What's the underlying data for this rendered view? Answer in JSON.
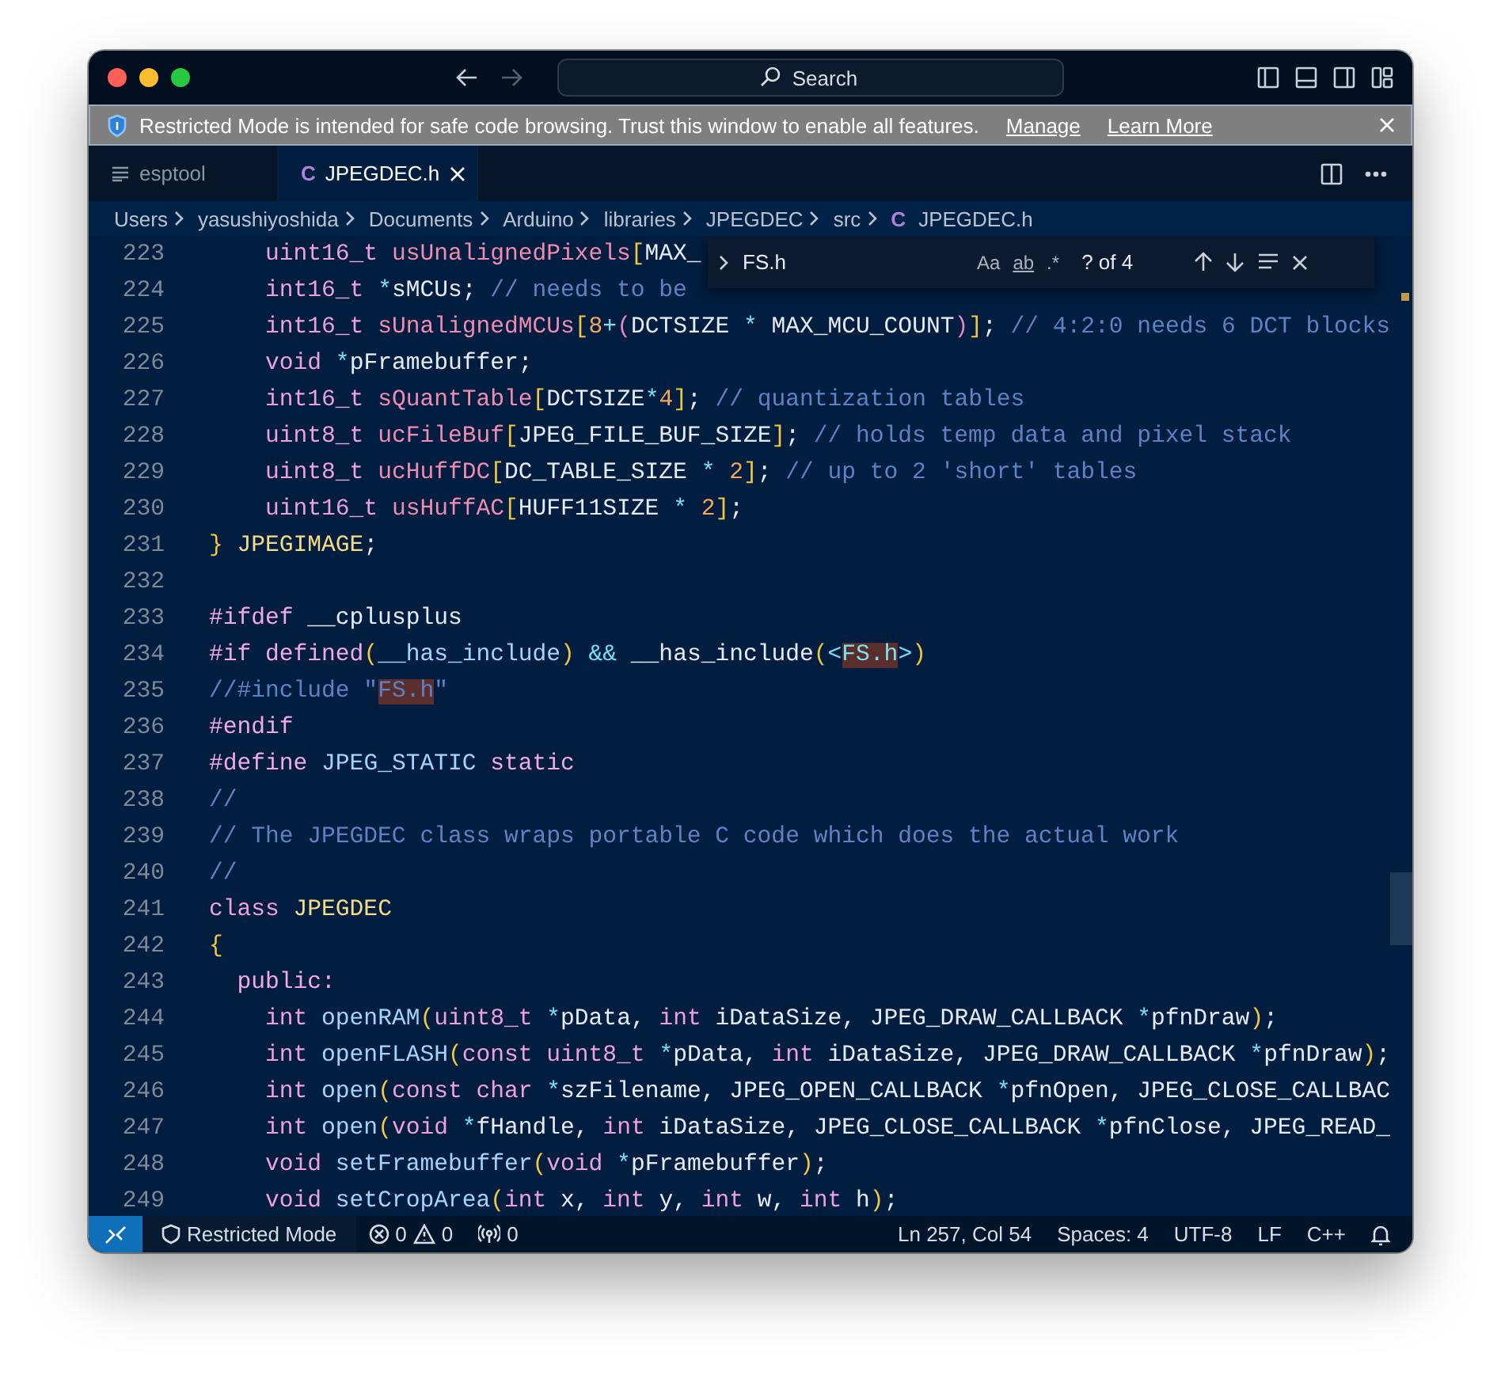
{
  "title_bar": {
    "search": {
      "placeholder": "Search"
    }
  },
  "banner": {
    "message": "Restricted Mode is intended for safe code browsing. Trust this window to enable all features.",
    "links": [
      "Manage",
      "Learn More"
    ]
  },
  "tabs": [
    {
      "label": "esptool",
      "kind": "text",
      "selected": false
    },
    {
      "label": "JPEGDEC.h",
      "kind": "c",
      "icon_text": "C",
      "selected": true
    }
  ],
  "breadcrumb": [
    {
      "label": "Users"
    },
    {
      "label": "yasushiyoshida"
    },
    {
      "label": "Documents"
    },
    {
      "label": "Arduino"
    },
    {
      "label": "libraries"
    },
    {
      "label": "JPEGDEC"
    },
    {
      "label": "src"
    },
    {
      "label": "JPEGDEC.h",
      "icon_text": "C"
    }
  ],
  "find_widget": {
    "value": "FS.h",
    "options": [
      "Aa",
      "ab",
      ".*"
    ],
    "result": "? of 4"
  },
  "editor": {
    "lines": [
      {
        "number": "223",
        "tokens": [
          {
            "text": "    uint16_t ",
            "kind": "type"
          },
          {
            "text": "usUnalignedPixels",
            "kind": "member"
          },
          {
            "text": "[",
            "kind": "bracket"
          },
          {
            "text": "MAX_",
            "kind": "plain"
          }
        ]
      },
      {
        "number": "224",
        "tokens": [
          {
            "text": "    int16_t ",
            "kind": "type"
          },
          {
            "text": "*",
            "kind": "op"
          },
          {
            "text": "sMCUs;",
            "kind": "plain"
          },
          {
            "text": " // needs to be",
            "kind": "comment"
          }
        ]
      },
      {
        "number": "225",
        "tokens": [
          {
            "text": "    int16_t ",
            "kind": "type"
          },
          {
            "text": "sUnalignedMCUs",
            "kind": "member"
          },
          {
            "text": "[",
            "kind": "bracket"
          },
          {
            "text": "8",
            "kind": "num"
          },
          {
            "text": "+",
            "kind": "op"
          },
          {
            "text": "(",
            "kind": "bracket2"
          },
          {
            "text": "DCTSIZE ",
            "kind": "plain"
          },
          {
            "text": "*",
            "kind": "op"
          },
          {
            "text": " MAX_MCU_COUNT",
            "kind": "plain"
          },
          {
            "text": ")",
            "kind": "bracket2"
          },
          {
            "text": "]",
            "kind": "bracket"
          },
          {
            "text": ";",
            "kind": "plain"
          },
          {
            "text": " // 4:2:0 needs 6 DCT blocks",
            "kind": "comment"
          }
        ]
      },
      {
        "number": "226",
        "tokens": [
          {
            "text": "    void ",
            "kind": "type"
          },
          {
            "text": "*",
            "kind": "op"
          },
          {
            "text": "pFramebuffer;",
            "kind": "plain"
          }
        ]
      },
      {
        "number": "227",
        "tokens": [
          {
            "text": "    int16_t ",
            "kind": "type"
          },
          {
            "text": "sQuantTable",
            "kind": "member"
          },
          {
            "text": "[",
            "kind": "bracket"
          },
          {
            "text": "DCTSIZE",
            "kind": "plain"
          },
          {
            "text": "*",
            "kind": "op"
          },
          {
            "text": "4",
            "kind": "num"
          },
          {
            "text": "]",
            "kind": "bracket"
          },
          {
            "text": ";",
            "kind": "plain"
          },
          {
            "text": " // quantization tables",
            "kind": "comment"
          }
        ]
      },
      {
        "number": "228",
        "tokens": [
          {
            "text": "    uint8_t ",
            "kind": "type"
          },
          {
            "text": "ucFileBuf",
            "kind": "member"
          },
          {
            "text": "[",
            "kind": "bracket"
          },
          {
            "text": "JPEG_FILE_BUF_SIZE",
            "kind": "plain"
          },
          {
            "text": "]",
            "kind": "bracket"
          },
          {
            "text": ";",
            "kind": "plain"
          },
          {
            "text": " // holds temp data and pixel stack",
            "kind": "comment"
          }
        ]
      },
      {
        "number": "229",
        "tokens": [
          {
            "text": "    uint8_t ",
            "kind": "type"
          },
          {
            "text": "ucHuffDC",
            "kind": "member"
          },
          {
            "text": "[",
            "kind": "bracket"
          },
          {
            "text": "DC_TABLE_SIZE ",
            "kind": "plain"
          },
          {
            "text": "* ",
            "kind": "op"
          },
          {
            "text": "2",
            "kind": "num"
          },
          {
            "text": "]",
            "kind": "bracket"
          },
          {
            "text": ";",
            "kind": "plain"
          },
          {
            "text": " // up to 2 'short' tables",
            "kind": "comment"
          }
        ]
      },
      {
        "number": "230",
        "tokens": [
          {
            "text": "    uint16_t ",
            "kind": "type"
          },
          {
            "text": "usHuffAC",
            "kind": "member"
          },
          {
            "text": "[",
            "kind": "bracket"
          },
          {
            "text": "HUFF11SIZE ",
            "kind": "plain"
          },
          {
            "text": "* ",
            "kind": "op"
          },
          {
            "text": "2",
            "kind": "num"
          },
          {
            "text": "]",
            "kind": "bracket"
          },
          {
            "text": ";",
            "kind": "plain"
          }
        ]
      },
      {
        "number": "231",
        "tokens": [
          {
            "text": "}",
            "kind": "bracket"
          },
          {
            "text": " JPEGIMAGE",
            "kind": "name"
          },
          {
            "text": ";",
            "kind": "plain"
          }
        ]
      },
      {
        "number": "232"
      },
      {
        "number": "233",
        "tokens": [
          {
            "text": "#ifdef",
            "kind": "directive"
          },
          {
            "text": " __cplusplus",
            "kind": "plain"
          }
        ]
      },
      {
        "number": "234",
        "tokens": [
          {
            "text": "#if defined",
            "kind": "directive"
          },
          {
            "text": "(",
            "kind": "bracket"
          },
          {
            "text": "__has_include",
            "kind": "func"
          },
          {
            "text": ")",
            "kind": "bracket"
          },
          {
            "text": " &&",
            "kind": "op"
          },
          {
            "text": " __has_include",
            "kind": "plain"
          },
          {
            "text": "(",
            "kind": "bracket"
          },
          {
            "text": "<",
            "kind": "op"
          },
          {
            "text": "FS.h",
            "kind": "match"
          },
          {
            "text": ">",
            "kind": "op"
          },
          {
            "text": ")",
            "kind": "bracket"
          }
        ]
      },
      {
        "number": "235",
        "tokens": [
          {
            "text": "//#include \"",
            "kind": "comment"
          },
          {
            "text": "FS.h",
            "kind": "comment-match"
          },
          {
            "text": "\"",
            "kind": "comment"
          }
        ]
      },
      {
        "number": "236",
        "tokens": [
          {
            "text": "#endif",
            "kind": "directive"
          }
        ]
      },
      {
        "number": "237",
        "tokens": [
          {
            "text": "#define",
            "kind": "directive"
          },
          {
            "text": " JPEG_STATIC ",
            "kind": "func"
          },
          {
            "text": "static",
            "kind": "directive"
          }
        ]
      },
      {
        "number": "238",
        "tokens": [
          {
            "text": "//",
            "kind": "comment"
          }
        ]
      },
      {
        "number": "239",
        "tokens": [
          {
            "text": "// The JPEGDEC class wraps portable C code which does the actual work",
            "kind": "comment"
          }
        ]
      },
      {
        "number": "240",
        "tokens": [
          {
            "text": "//",
            "kind": "comment"
          }
        ]
      },
      {
        "number": "241",
        "tokens": [
          {
            "text": "class",
            "kind": "type"
          },
          {
            "text": " JPEGDEC",
            "kind": "name"
          }
        ]
      },
      {
        "number": "242",
        "tokens": [
          {
            "text": "{",
            "kind": "bracket"
          }
        ]
      },
      {
        "number": "243",
        "tokens": [
          {
            "text": "  public:",
            "kind": "directive"
          }
        ]
      },
      {
        "number": "244",
        "tokens": [
          {
            "text": "    int ",
            "kind": "type"
          },
          {
            "text": "openRAM",
            "kind": "func"
          },
          {
            "text": "(",
            "kind": "bracket"
          },
          {
            "text": "uint8_t ",
            "kind": "type"
          },
          {
            "text": "*",
            "kind": "op"
          },
          {
            "text": "pData, ",
            "kind": "plain"
          },
          {
            "text": "int",
            "kind": "type"
          },
          {
            "text": " iDataSize, JPEG_DRAW_CALLBACK ",
            "kind": "plain"
          },
          {
            "text": "*",
            "kind": "op"
          },
          {
            "text": "pfnDraw",
            "kind": "plain"
          },
          {
            "text": ")",
            "kind": "bracket"
          },
          {
            "text": ";",
            "kind": "plain"
          }
        ]
      },
      {
        "number": "245",
        "tokens": [
          {
            "text": "    int ",
            "kind": "type"
          },
          {
            "text": "openFLASH",
            "kind": "func"
          },
          {
            "text": "(",
            "kind": "bracket"
          },
          {
            "text": "const uint8_t ",
            "kind": "type"
          },
          {
            "text": "*",
            "kind": "op"
          },
          {
            "text": "pData, ",
            "kind": "plain"
          },
          {
            "text": "int",
            "kind": "type"
          },
          {
            "text": " iDataSize, JPEG_DRAW_CALLBACK ",
            "kind": "plain"
          },
          {
            "text": "*",
            "kind": "op"
          },
          {
            "text": "pfnDraw",
            "kind": "plain"
          },
          {
            "text": ")",
            "kind": "bracket"
          },
          {
            "text": ";",
            "kind": "plain"
          }
        ]
      },
      {
        "number": "246",
        "tokens": [
          {
            "text": "    int ",
            "kind": "type"
          },
          {
            "text": "open",
            "kind": "func"
          },
          {
            "text": "(",
            "kind": "bracket"
          },
          {
            "text": "const char ",
            "kind": "type"
          },
          {
            "text": "*",
            "kind": "op"
          },
          {
            "text": "szFilename, JPEG_OPEN_CALLBACK ",
            "kind": "plain"
          },
          {
            "text": "*",
            "kind": "op"
          },
          {
            "text": "pfnOpen, JPEG_CLOSE_CALLBAC",
            "kind": "plain"
          }
        ]
      },
      {
        "number": "247",
        "tokens": [
          {
            "text": "    int ",
            "kind": "type"
          },
          {
            "text": "open",
            "kind": "func"
          },
          {
            "text": "(",
            "kind": "bracket"
          },
          {
            "text": "void ",
            "kind": "type"
          },
          {
            "text": "*",
            "kind": "op"
          },
          {
            "text": "fHandle, ",
            "kind": "plain"
          },
          {
            "text": "int",
            "kind": "type"
          },
          {
            "text": " iDataSize, JPEG_CLOSE_CALLBACK ",
            "kind": "plain"
          },
          {
            "text": "*",
            "kind": "op"
          },
          {
            "text": "pfnClose, JPEG_READ_",
            "kind": "plain"
          }
        ]
      },
      {
        "number": "248",
        "tokens": [
          {
            "text": "    void ",
            "kind": "type"
          },
          {
            "text": "setFramebuffer",
            "kind": "func"
          },
          {
            "text": "(",
            "kind": "bracket"
          },
          {
            "text": "void ",
            "kind": "type"
          },
          {
            "text": "*",
            "kind": "op"
          },
          {
            "text": "pFramebuffer",
            "kind": "plain"
          },
          {
            "text": ")",
            "kind": "bracket"
          },
          {
            "text": ";",
            "kind": "plain"
          }
        ]
      },
      {
        "number": "249",
        "tokens": [
          {
            "text": "    void ",
            "kind": "type"
          },
          {
            "text": "setCropArea",
            "kind": "func"
          },
          {
            "text": "(",
            "kind": "bracket"
          },
          {
            "text": "int",
            "kind": "type"
          },
          {
            "text": " x, ",
            "kind": "plain"
          },
          {
            "text": "int",
            "kind": "type"
          },
          {
            "text": " y, ",
            "kind": "plain"
          },
          {
            "text": "int",
            "kind": "type"
          },
          {
            "text": " w, ",
            "kind": "plain"
          },
          {
            "text": "int",
            "kind": "type"
          },
          {
            "text": " h",
            "kind": "plain"
          },
          {
            "text": ")",
            "kind": "bracket"
          },
          {
            "text": ";",
            "kind": "plain"
          }
        ]
      }
    ]
  },
  "status_bar": {
    "mode": "Restricted Mode",
    "errors": "0",
    "warnings": "0",
    "ports": "0",
    "position": "Ln 257, Col 54",
    "indentation": "Spaces: 4",
    "encoding": "UTF-8",
    "eol": "LF",
    "language": "C++"
  }
}
